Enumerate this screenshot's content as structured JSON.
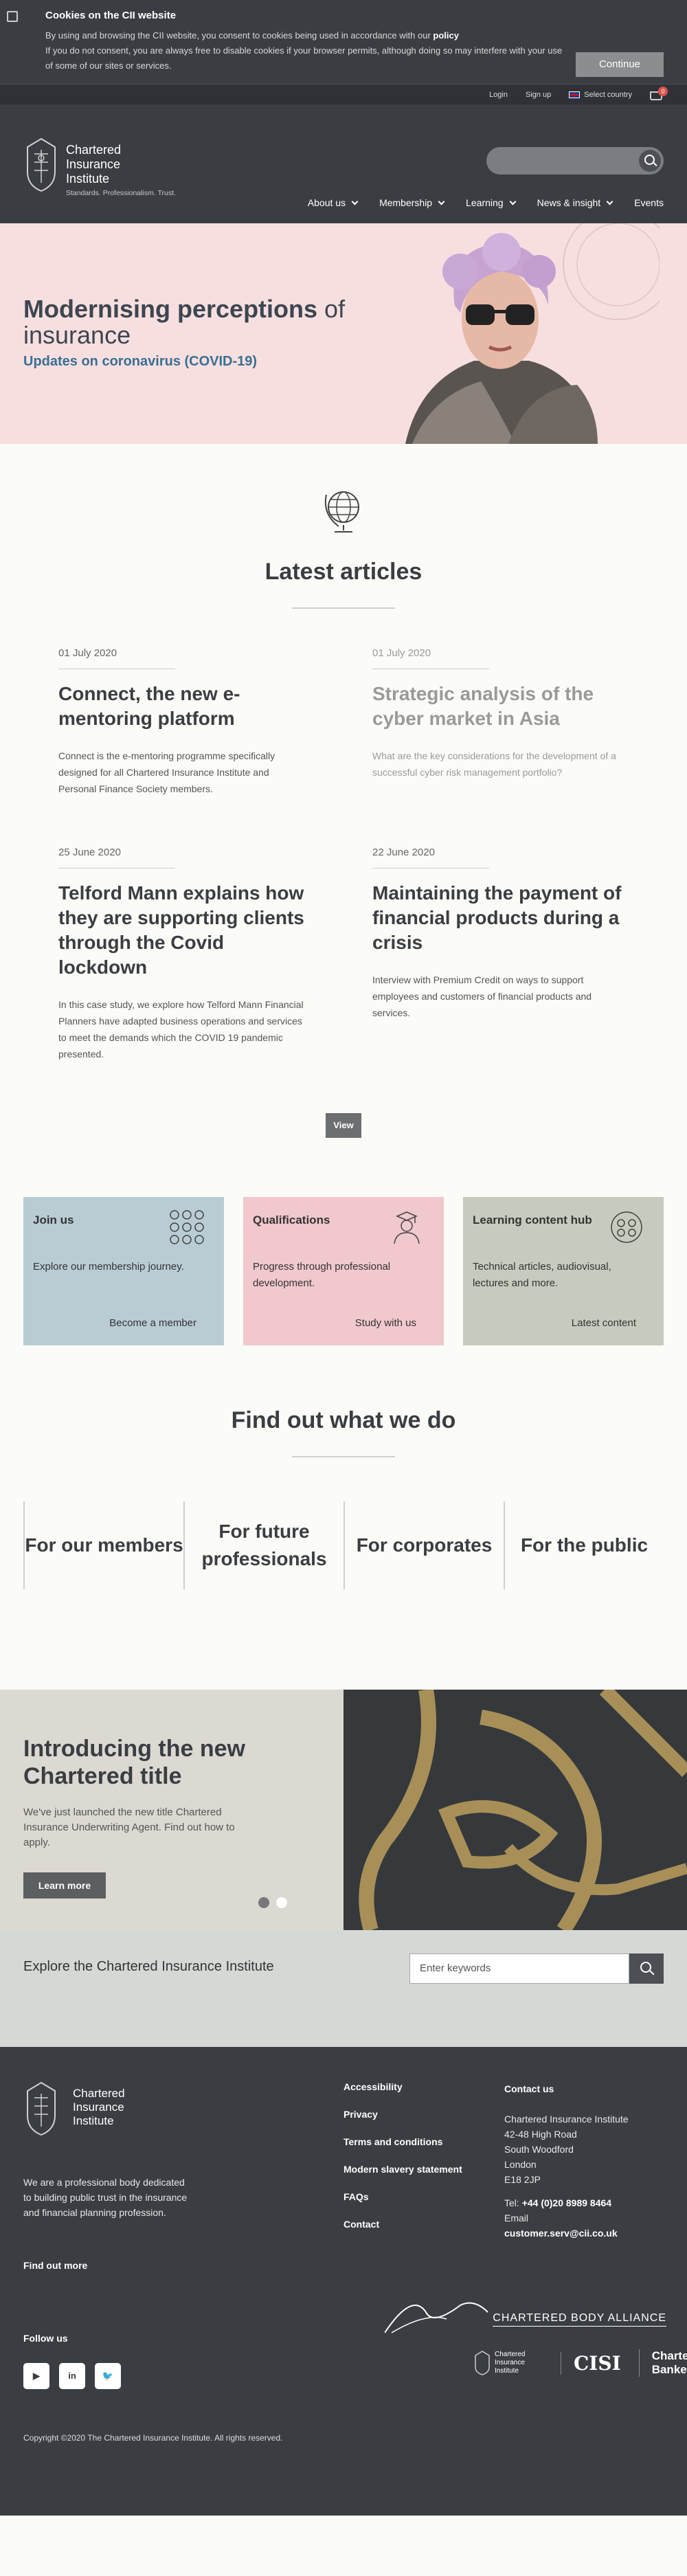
{
  "cookie": {
    "title": "Cookies on the CII website",
    "line1_pre": "By using and browsing the CII website, you consent to cookies being used in accordance with our ",
    "line1_link": "policy",
    "line2": "If you do not consent, you are always free to disable cookies if your browser permits, although doing so may interfere with your use of some of our sites or services.",
    "button": "Continue"
  },
  "util": {
    "login": "Login",
    "signup": "Sign up",
    "country": "Select country",
    "basket_count": "0"
  },
  "header": {
    "logo_line1": "Chartered",
    "logo_line2": "Insurance",
    "logo_line3": "Institute",
    "tagline": "Standards. Professionalism. Trust.",
    "nav": [
      "About us",
      "Membership",
      "Learning",
      "News & insight",
      "Events"
    ]
  },
  "hero": {
    "title_bold": "Modernising perceptions",
    "title_rest": " of insurance",
    "link": "Updates on coronavirus (COVID-19)"
  },
  "articles": {
    "title": "Latest articles",
    "items": [
      {
        "date": "01 July 2020",
        "title": "Connect, the new e-mentoring platform",
        "text": "Connect is the e-mentoring programme specifically designed for all Chartered Insurance Institute and Personal Finance Society members."
      },
      {
        "date": "01 July 2020",
        "title": "Strategic analysis of the cyber market in Asia",
        "text": "What are the key considerations for the development of a successful cyber risk management portfolio?"
      },
      {
        "date": "25 June 2020",
        "title": "Telford Mann explains how they are supporting clients through the Covid lockdown",
        "text": "In this case study, we explore how Telford Mann Financial Planners have adapted business operations and services to meet the demands which the COVID 19 pandemic presented."
      },
      {
        "date": "22 June 2020",
        "title": "Maintaining the payment of financial products during a crisis",
        "text": "Interview with Premium Credit on ways to support employees and customers of financial products and services."
      }
    ],
    "view": "View"
  },
  "tiles": [
    {
      "title": "Join us",
      "desc": "Explore our membership journey.",
      "link": "Become a member"
    },
    {
      "title": "Qualifications",
      "desc": "Progress through professional development.",
      "link": "Study with us"
    },
    {
      "title": "Learning content hub",
      "desc": "Technical articles, audiovisual, lectures and more.",
      "link": "Latest content"
    }
  ],
  "findout": {
    "title": "Find out what we do",
    "items": [
      "For our members",
      "For future professionals",
      "For corporates",
      "For the public"
    ]
  },
  "promo": {
    "title": "Introducing the new Chartered title",
    "text": "We've just launched the new title Chartered Insurance Underwriting Agent. Find out how to apply.",
    "button": "Learn more"
  },
  "explore": {
    "title": "Explore the Chartered Insurance Institute",
    "placeholder": "Enter keywords"
  },
  "footer": {
    "logo_line1": "Chartered",
    "logo_line2": "Insurance",
    "logo_line3": "Institute",
    "about": "We are a professional body dedicated to building public trust in the insurance and financial planning profession.",
    "find_more": "Find out more",
    "follow": "Follow us",
    "links": [
      "Accessibility",
      "Privacy",
      "Terms and conditions",
      "Modern slavery statement",
      "FAQs",
      "Contact"
    ],
    "contact_title": "Contact us",
    "address": [
      "Chartered Insurance Institute",
      "42-48 High Road",
      "South Woodford",
      "London",
      "E18 2JP"
    ],
    "tel_label": "Tel: ",
    "tel": "+44 (0)20 8989 8464",
    "email_label": "Email",
    "email": "customer.serv@cii.co.uk",
    "alliance": "CHARTERED BODY ALLIANCE",
    "member_cii": "Chartered Insurance Institute",
    "member_cisi": "CISI",
    "member_cb1": "Chartered",
    "member_cb2": "Banker",
    "copyright": "Copyright ©2020 The Chartered Insurance Institute. All rights reserved."
  }
}
